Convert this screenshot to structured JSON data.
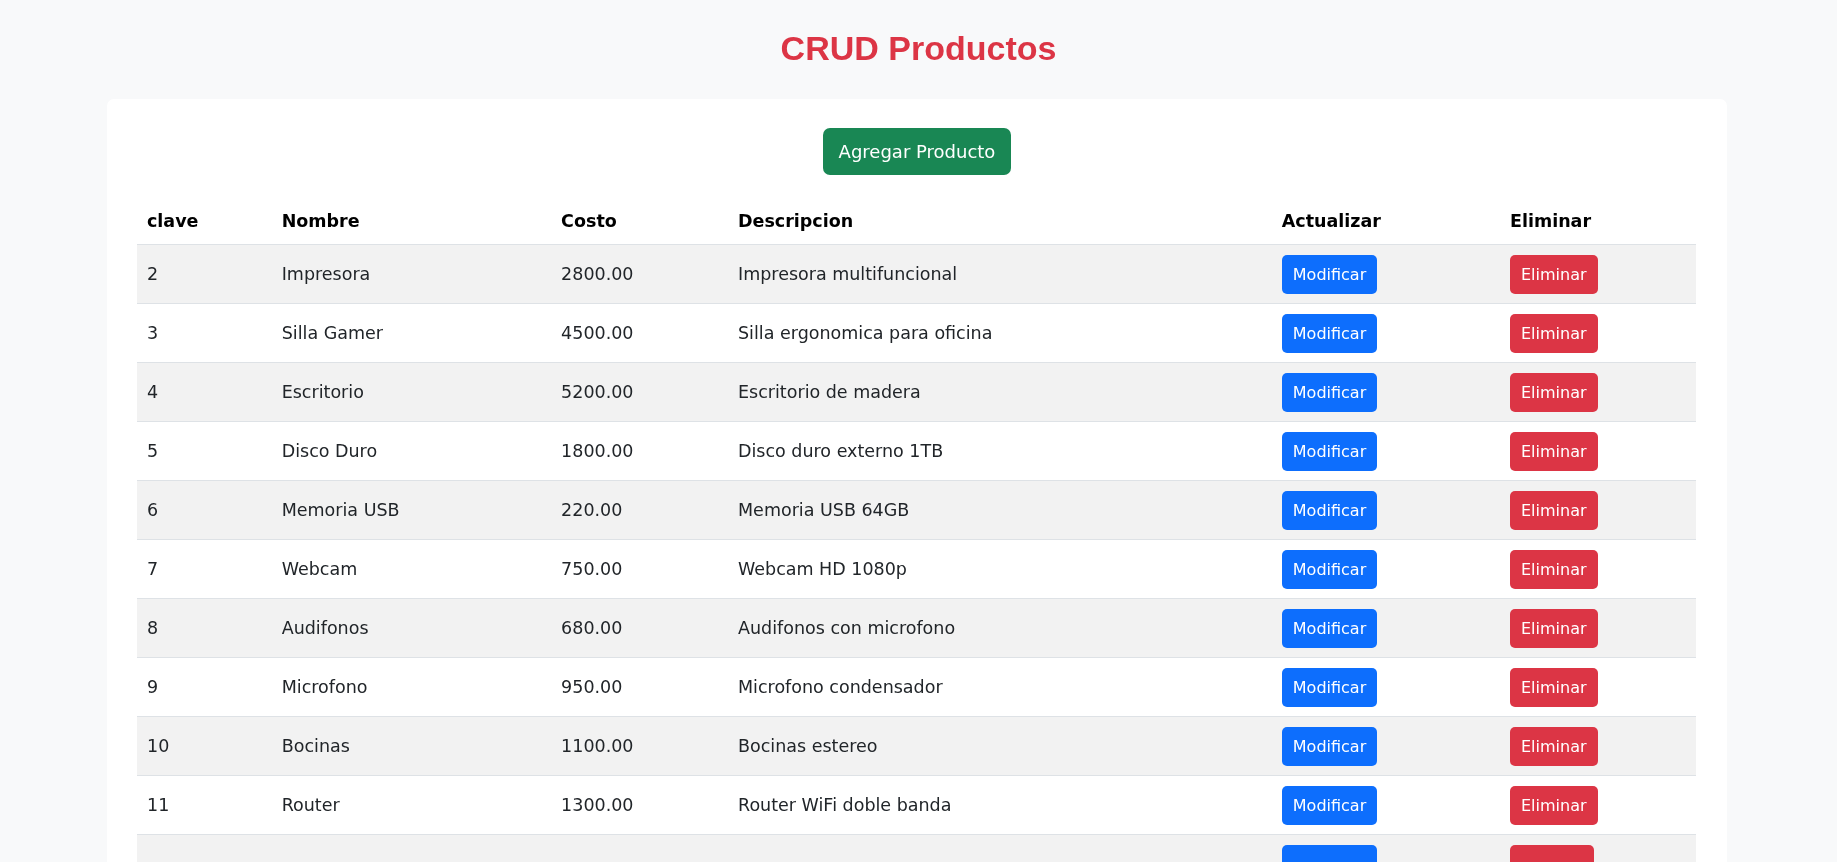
{
  "title": "CRUD Productos",
  "add_button": "Agregar Producto",
  "table": {
    "columns": [
      "clave",
      "Nombre",
      "Costo",
      "Descripcion",
      "Actualizar",
      "Eliminar"
    ],
    "rows": [
      {
        "clave": "2",
        "nombre": "Impresora",
        "costo": "2800.00",
        "descripcion": "Impresora multifuncional",
        "update": "Modificar",
        "delete": "Eliminar"
      },
      {
        "clave": "3",
        "nombre": "Silla Gamer",
        "costo": "4500.00",
        "descripcion": "Silla ergonomica para oficina",
        "update": "Modificar",
        "delete": "Eliminar"
      },
      {
        "clave": "4",
        "nombre": "Escritorio",
        "costo": "5200.00",
        "descripcion": "Escritorio de madera",
        "update": "Modificar",
        "delete": "Eliminar"
      },
      {
        "clave": "5",
        "nombre": "Disco Duro",
        "costo": "1800.00",
        "descripcion": "Disco duro externo 1TB",
        "update": "Modificar",
        "delete": "Eliminar"
      },
      {
        "clave": "6",
        "nombre": "Memoria USB",
        "costo": "220.00",
        "descripcion": "Memoria USB 64GB",
        "update": "Modificar",
        "delete": "Eliminar"
      },
      {
        "clave": "7",
        "nombre": "Webcam",
        "costo": "750.00",
        "descripcion": "Webcam HD 1080p",
        "update": "Modificar",
        "delete": "Eliminar"
      },
      {
        "clave": "8",
        "nombre": "Audifonos",
        "costo": "680.00",
        "descripcion": "Audifonos con microfono",
        "update": "Modificar",
        "delete": "Eliminar"
      },
      {
        "clave": "9",
        "nombre": "Microfono",
        "costo": "950.00",
        "descripcion": "Microfono condensador",
        "update": "Modificar",
        "delete": "Eliminar"
      },
      {
        "clave": "10",
        "nombre": "Bocinas",
        "costo": "1100.00",
        "descripcion": "Bocinas estereo",
        "update": "Modificar",
        "delete": "Eliminar"
      },
      {
        "clave": "11",
        "nombre": "Router",
        "costo": "1300.00",
        "descripcion": "Router WiFi doble banda",
        "update": "Modificar",
        "delete": "Eliminar"
      }
    ]
  }
}
